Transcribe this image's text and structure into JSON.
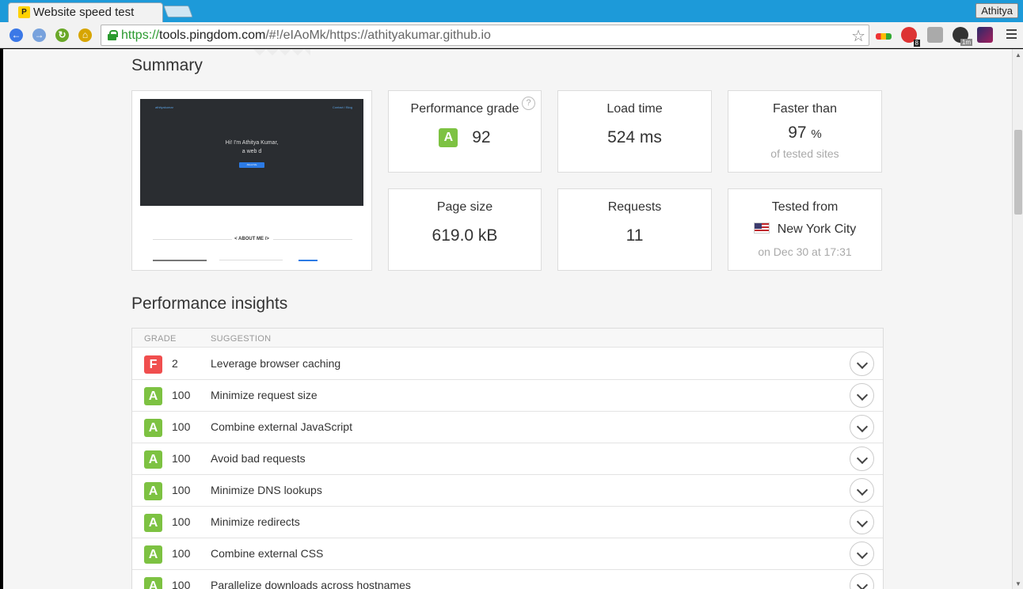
{
  "browser": {
    "tab_title": "Website speed test",
    "tab_favicon_letter": "P",
    "profile_name": "Athitya",
    "url": {
      "scheme": "https://",
      "host": "tools.pingdom.com",
      "path": "/#!/eIAoMk/https://athityakumar.github.io"
    },
    "extension_badges": {
      "ext_count": "8",
      "clock_label": "1m"
    }
  },
  "summary": {
    "title": "Summary",
    "screenshot": {
      "nav_left": "athityakumar",
      "nav_right": "Contact / Blog",
      "hero_line1": "Hi! I'm Athitya Kumar,",
      "hero_line2": "a web d",
      "hero_button": "About Me",
      "about_heading": "< ABOUT ME />"
    },
    "performance_grade": {
      "label": "Performance grade",
      "grade": "A",
      "score": "92",
      "help": "?"
    },
    "load_time": {
      "label": "Load time",
      "value": "524 ms"
    },
    "faster_than": {
      "label": "Faster than",
      "value": "97",
      "unit": "%",
      "sub": "of tested sites"
    },
    "page_size": {
      "label": "Page size",
      "value": "619.0 kB"
    },
    "requests": {
      "label": "Requests",
      "value": "11"
    },
    "tested_from": {
      "label": "Tested from",
      "location": "New York City",
      "sub": "on Dec 30 at 17:31"
    }
  },
  "insights": {
    "title": "Performance insights",
    "columns": {
      "grade": "GRADE",
      "suggestion": "SUGGESTION"
    },
    "rows": [
      {
        "grade": "F",
        "score": "2",
        "suggestion": "Leverage browser caching"
      },
      {
        "grade": "A",
        "score": "100",
        "suggestion": "Minimize request size"
      },
      {
        "grade": "A",
        "score": "100",
        "suggestion": "Combine external JavaScript"
      },
      {
        "grade": "A",
        "score": "100",
        "suggestion": "Avoid bad requests"
      },
      {
        "grade": "A",
        "score": "100",
        "suggestion": "Minimize DNS lookups"
      },
      {
        "grade": "A",
        "score": "100",
        "suggestion": "Minimize redirects"
      },
      {
        "grade": "A",
        "score": "100",
        "suggestion": "Combine external CSS"
      },
      {
        "grade": "A",
        "score": "100",
        "suggestion": "Parallelize downloads across hostnames"
      }
    ]
  },
  "colors": {
    "grade_A": "#7dc242",
    "grade_F": "#f04e4e",
    "tabstrip": "#1d9ad9"
  }
}
